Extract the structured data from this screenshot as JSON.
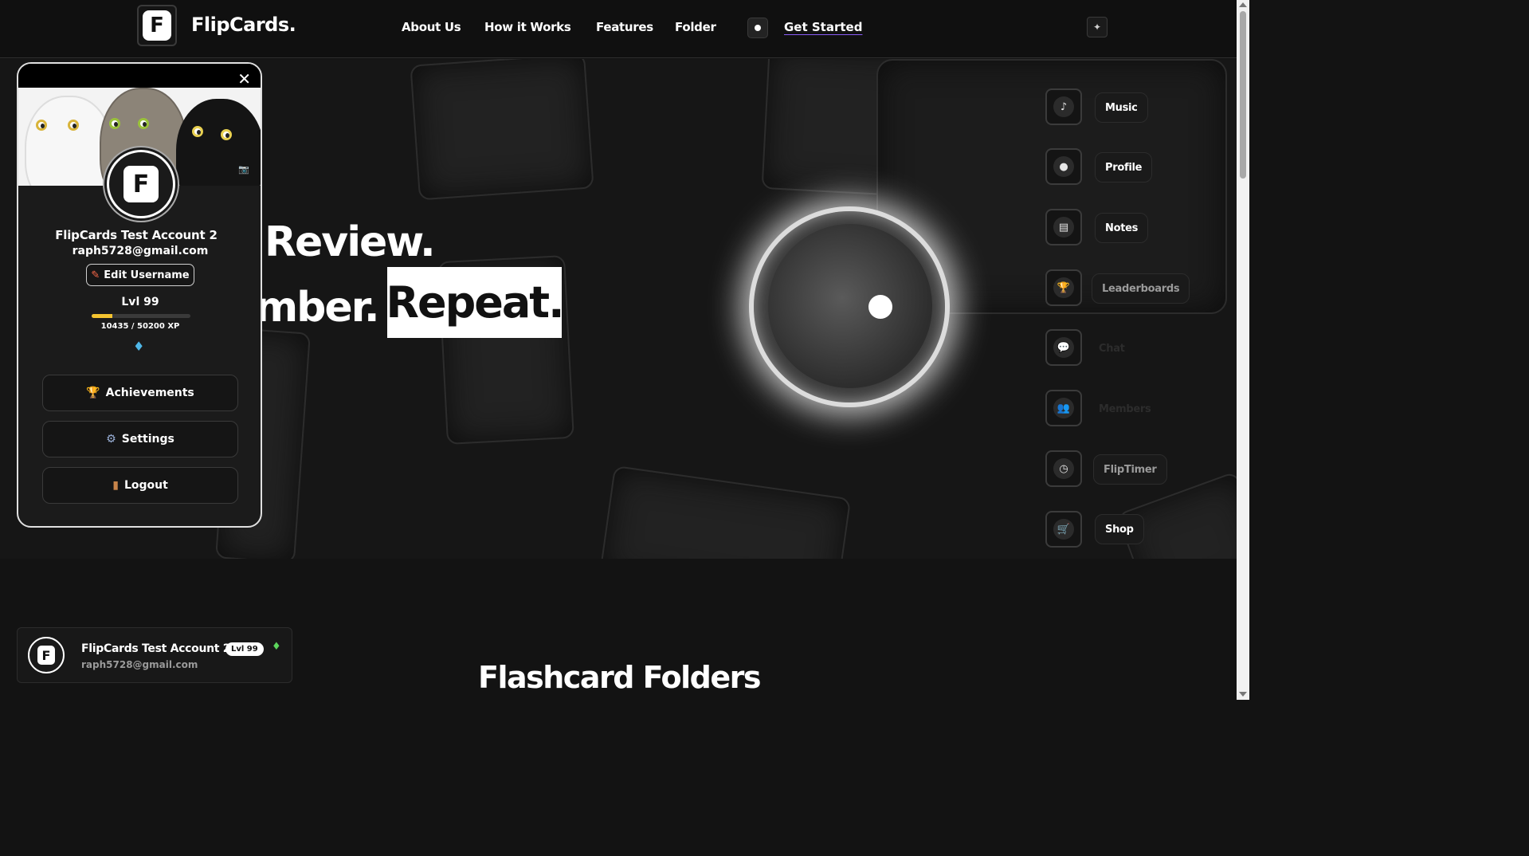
{
  "header": {
    "brand": "FlipCards.",
    "logo_letter": "F",
    "nav": [
      "About Us",
      "How it Works",
      "Features",
      "Folder"
    ],
    "cta": "Get Started"
  },
  "hero": {
    "line1": "Review.",
    "line2": "mber.",
    "highlight": "Repeat."
  },
  "sidebar": {
    "items": [
      {
        "label": "Music",
        "icon": "music-note-icon",
        "glyph": "♪"
      },
      {
        "label": "Profile",
        "icon": "user-icon",
        "glyph": "●"
      },
      {
        "label": "Notes",
        "icon": "notes-icon",
        "glyph": "▤"
      },
      {
        "label": "Leaderboards",
        "icon": "trophy-icon",
        "glyph": "🏆"
      },
      {
        "label": "Chat",
        "icon": "chat-icon",
        "glyph": "💬"
      },
      {
        "label": "Members",
        "icon": "members-icon",
        "glyph": "👥"
      },
      {
        "label": "FlipTimer",
        "icon": "timer-icon",
        "glyph": "◷"
      },
      {
        "label": "Shop",
        "icon": "cart-icon",
        "glyph": "🛒"
      }
    ]
  },
  "profile_popup": {
    "name": "FlipCards Test Account 2",
    "email": "raph5728@gmail.com",
    "edit_label": "Edit Username",
    "level": "Lvl 99",
    "xp_text": "10435 / 50200 XP",
    "xp_fraction": 0.208,
    "buttons": {
      "achievements": "Achievements",
      "settings": "Settings",
      "logout": "Logout"
    }
  },
  "user_card": {
    "name": "FlipCards Test Account 2",
    "level_badge": "Lvl 99",
    "email": "raph5728@gmail.com"
  },
  "section": {
    "title": "Flashcard Folders"
  },
  "colors": {
    "background": "#131313",
    "accent_underline": "#8a5cf6",
    "xp_fill": "#f4c430"
  }
}
